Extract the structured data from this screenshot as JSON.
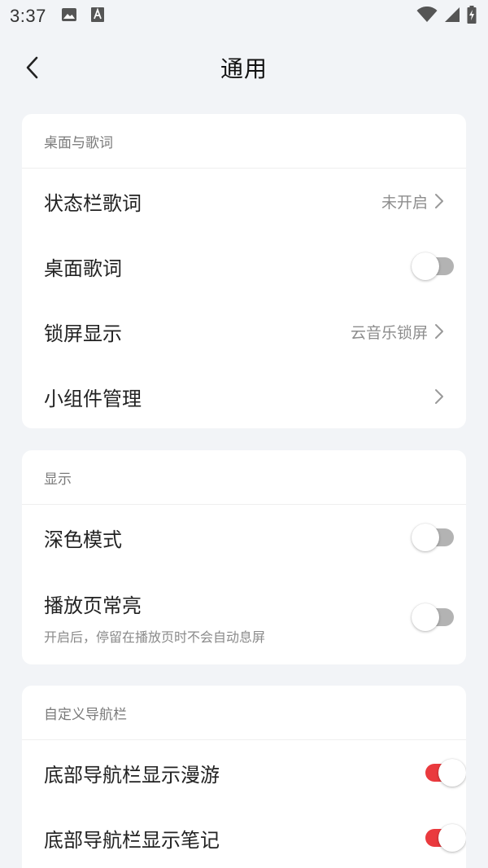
{
  "status_bar": {
    "time": "3:37",
    "left_icons": [
      "image-icon",
      "text-a-icon"
    ],
    "right_icons": [
      "wifi-icon",
      "signal-icon",
      "battery-charging-icon"
    ]
  },
  "header": {
    "title": "通用"
  },
  "sections": [
    {
      "title": "桌面与歌词",
      "rows": [
        {
          "label": "状态栏歌词",
          "value": "未开启",
          "type": "nav"
        },
        {
          "label": "桌面歌词",
          "type": "toggle",
          "on": false
        },
        {
          "label": "锁屏显示",
          "value": "云音乐锁屏",
          "type": "nav"
        },
        {
          "label": "小组件管理",
          "value": "",
          "type": "nav"
        }
      ]
    },
    {
      "title": "显示",
      "rows": [
        {
          "label": "深色模式",
          "type": "toggle",
          "on": false
        },
        {
          "label": "播放页常亮",
          "subtitle": "开启后，停留在播放页时不会自动息屏",
          "type": "toggle",
          "on": false
        }
      ]
    },
    {
      "title": "自定义导航栏",
      "rows": [
        {
          "label": "底部导航栏显示漫游",
          "type": "toggle",
          "on": true
        },
        {
          "label": "底部导航栏显示笔记",
          "type": "toggle",
          "on": true
        }
      ]
    }
  ],
  "colors": {
    "accent": "#ea3a3e",
    "background": "#f2f4f7",
    "toggle_off": "#b3b3b3"
  }
}
